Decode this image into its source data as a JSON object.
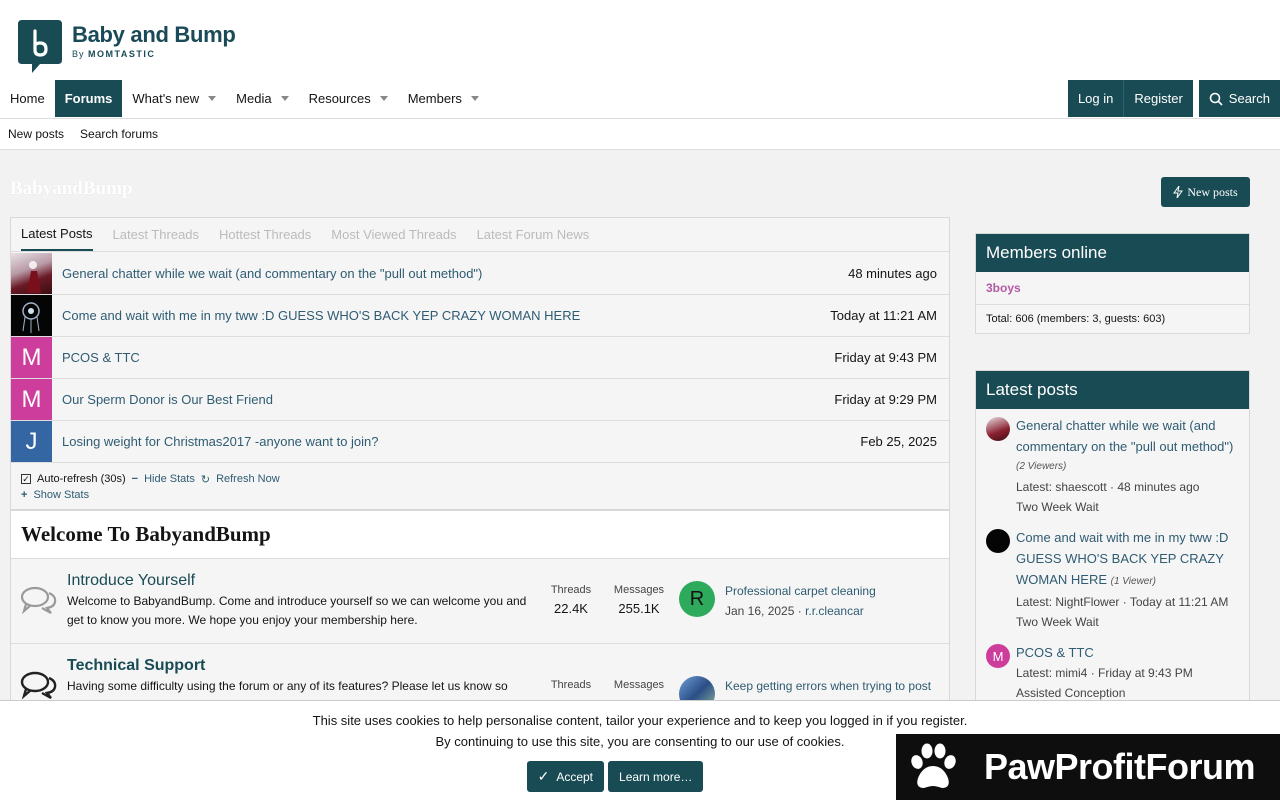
{
  "brand": {
    "title": "Baby and Bump",
    "by": "By",
    "by_brand": "MOMTASTIC"
  },
  "nav": {
    "items": [
      {
        "label": "Home",
        "dropdown": false
      },
      {
        "label": "Forums",
        "dropdown": false
      },
      {
        "label": "What's new",
        "dropdown": true
      },
      {
        "label": "Media",
        "dropdown": true
      },
      {
        "label": "Resources",
        "dropdown": true
      },
      {
        "label": "Members",
        "dropdown": true
      }
    ],
    "login": "Log in",
    "register": "Register",
    "search": "Search"
  },
  "subnav": {
    "new_posts": "New posts",
    "search_forums": "Search forums"
  },
  "page": {
    "title": "BabyandBump",
    "new_posts_button": "New posts"
  },
  "tabs": [
    "Latest Posts",
    "Latest Threads",
    "Hottest Threads",
    "Most Viewed Threads",
    "Latest Forum News"
  ],
  "latest_posts": [
    {
      "title": "General chatter while we wait (and commentary on the \"pull out method\")",
      "time": "48 minutes ago",
      "avatar": ""
    },
    {
      "title": "Come and wait with me in my tww :D GUESS WHO'S BACK YEP CRAZY WOMAN HERE",
      "time": "Today at 11:21 AM",
      "avatar": ""
    },
    {
      "title": "PCOS & TTC",
      "time": "Friday at 9:43 PM",
      "avatar": "M"
    },
    {
      "title": "Our Sperm Donor is Our Best Friend",
      "time": "Friday at 9:29 PM",
      "avatar": "M"
    },
    {
      "title": "Losing weight for Christmas2017 -anyone want to join?",
      "time": "Feb 25, 2025",
      "avatar": "J"
    }
  ],
  "refresh": {
    "auto": "Auto-refresh (30s)",
    "hide": "Hide Stats",
    "refresh_now": "Refresh Now",
    "show": "Show Stats"
  },
  "category": {
    "title": "Welcome To BabyandBump",
    "forums": [
      {
        "title": "Introduce Yourself",
        "desc": "Welcome to BabyandBump. Come and introduce yourself so we can welcome you and get to know you more. We hope you enjoy your membership here.",
        "threads_label": "Threads",
        "threads": "22.4K",
        "messages_label": "Messages",
        "messages": "255.1K",
        "last_title": "Professional carpet cleaning",
        "last_date": "Jan 16, 2025",
        "last_user": "r.r.cleancar",
        "last_avatar": "R"
      },
      {
        "title": "Technical Support",
        "desc": "Having some difficulty using the forum or any of its features? Please let us know so",
        "threads_label": "Threads",
        "threads": "",
        "messages_label": "Messages",
        "messages": "",
        "last_title": "Keep getting errors when trying to post",
        "last_date": "",
        "last_user": "",
        "last_avatar": ""
      }
    ]
  },
  "members_online": {
    "title": "Members online",
    "names": "3boys",
    "total": "Total: 606 (members: 3, guests: 603)"
  },
  "sidebar_latest": {
    "title": "Latest posts",
    "items": [
      {
        "title": "General chatter while we wait (and commentary on the \"pull out method\")",
        "viewers": "(2 Viewers)",
        "latest": "Latest: shaescott · 48 minutes ago",
        "forum": "Two Week Wait",
        "avatar": ""
      },
      {
        "title": "Come and wait with me in my tww :D GUESS WHO'S BACK YEP CRAZY WOMAN HERE",
        "viewers": "(1 Viewer)",
        "latest": "Latest: NightFlower · Today at 11:21 AM",
        "forum": "Two Week Wait",
        "avatar": ""
      },
      {
        "title": "PCOS & TTC",
        "viewers": "",
        "latest": "Latest: mimi4 · Friday at 9:43 PM",
        "forum": "Assisted Conception",
        "avatar": "M"
      }
    ]
  },
  "cookie": {
    "line1": "This site uses cookies to help personalise content, tailor your experience and to keep you logged in if you register.",
    "line2": "By continuing to use this site, you are consenting to our use of cookies.",
    "accept": "Accept",
    "learn": "Learn more…"
  },
  "watermark": {
    "text": "PawProfitForum"
  },
  "colors": {
    "primary": "#194b55",
    "link": "#2f5c72",
    "member": "#b35aa5"
  }
}
